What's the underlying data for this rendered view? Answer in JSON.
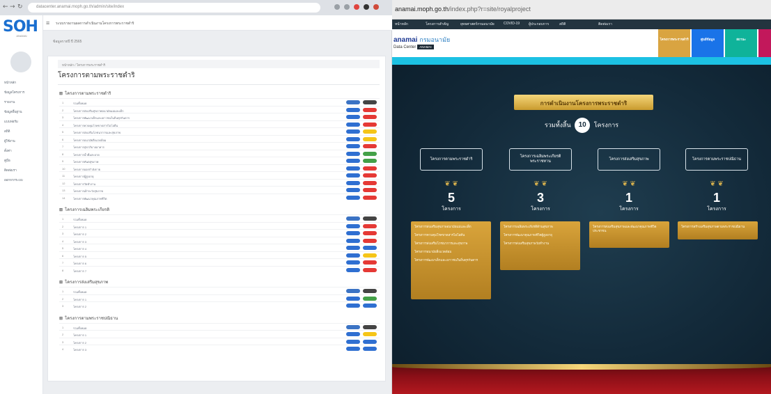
{
  "left": {
    "url": "datacenter.anamai.moph.go.th/admin/site/index",
    "topbar_text": "ระบบรายงานผลการดำเนินงานโครงการพระราชดำริ",
    "subtitle": "ข้อมูลรายปี   ปี 2565",
    "breadcrumb": "หน้าหลัก / โครงการพระราชดำริ",
    "page_title": "โครงการตามพระราชดำริ",
    "logo_big": "SOH",
    "logo_sub": "ANAMAI",
    "sidebar": [
      "หน้าหลัก",
      "ข้อมูลโครงการ",
      "รายงาน",
      "ข้อมูลพื้นฐาน",
      "แบบฟอร์ม",
      "สถิติ",
      "ผู้ใช้งาน",
      "ตั้งค่า",
      "คู่มือ",
      "ติดต่อเรา",
      "ออกจากระบบ"
    ],
    "groups": [
      {
        "title": "โครงการตามพระราชดำริ",
        "rows": [
          {
            "text": "รวมทั้งหมด",
            "c1": "#3b73c4",
            "c2": "#444444"
          },
          {
            "text": "โครงการส่งเสริมสุขภาพอนามัยแม่และเด็ก",
            "c1": "#2f6fd1",
            "c2": "#e53935"
          },
          {
            "text": "โครงการพัฒนาเด็กและเยาวชนในถิ่นทุรกันดาร",
            "c1": "#2f6fd1",
            "c2": "#e53935"
          },
          {
            "text": "โครงการควบคุมโรคขาดสารไอโอดีน",
            "c1": "#2f6fd1",
            "c2": "#e53935"
          },
          {
            "text": "โครงการส่งเสริมโภชนาการและสุขภาพ",
            "c1": "#2f6fd1",
            "c2": "#f5c518"
          },
          {
            "text": "โครงการอนามัยสิ่งแวดล้อม",
            "c1": "#2f6fd1",
            "c2": "#f5c518"
          },
          {
            "text": "โครงการสุขาภิบาลอาหาร",
            "c1": "#2f6fd1",
            "c2": "#e53935"
          },
          {
            "text": "โครงการน้ำดื่มสะอาด",
            "c1": "#2f6fd1",
            "c2": "#43a047"
          },
          {
            "text": "โครงการทันตสุขภาพ",
            "c1": "#2f6fd1",
            "c2": "#43a047"
          },
          {
            "text": "โครงการออกกำลังกาย",
            "c1": "#2f6fd1",
            "c2": "#e53935"
          },
          {
            "text": "โครงการผู้สูงอายุ",
            "c1": "#2f6fd1",
            "c2": "#e53935"
          },
          {
            "text": "โครงการวัยทำงาน",
            "c1": "#2f6fd1",
            "c2": "#e53935"
          },
          {
            "text": "โครงการเฝ้าระวังสุขภาพ",
            "c1": "#2f6fd1",
            "c2": "#e53935"
          },
          {
            "text": "โครงการพัฒนาคุณภาพชีวิต",
            "c1": "#2f6fd1",
            "c2": "#e53935"
          }
        ]
      },
      {
        "title": "โครงการเฉลิมพระเกียรติ",
        "rows": [
          {
            "text": "รวมทั้งหมด",
            "c1": "#3b73c4",
            "c2": "#444444"
          },
          {
            "text": "โครงการ 1",
            "c1": "#2f6fd1",
            "c2": "#e53935"
          },
          {
            "text": "โครงการ 2",
            "c1": "#2f6fd1",
            "c2": "#e53935"
          },
          {
            "text": "โครงการ 3",
            "c1": "#2f6fd1",
            "c2": "#e53935"
          },
          {
            "text": "โครงการ 4",
            "c1": "#2f6fd1",
            "c2": "#2f6fd1"
          },
          {
            "text": "โครงการ 5",
            "c1": "#2f6fd1",
            "c2": "#f5c518"
          },
          {
            "text": "โครงการ 6",
            "c1": "#2f6fd1",
            "c2": "#e53935"
          },
          {
            "text": "โครงการ 7",
            "c1": "#2f6fd1",
            "c2": "#e53935"
          }
        ]
      },
      {
        "title": "โครงการส่งเสริมสุขภาพ",
        "rows": [
          {
            "text": "รวมทั้งหมด",
            "c1": "#3b73c4",
            "c2": "#444444"
          },
          {
            "text": "โครงการ 1",
            "c1": "#2f6fd1",
            "c2": "#43a047"
          },
          {
            "text": "โครงการ 2",
            "c1": "#2f6fd1",
            "c2": "#2f6fd1"
          }
        ]
      },
      {
        "title": "โครงการตามพระราชปณิธาน",
        "rows": [
          {
            "text": "รวมทั้งหมด",
            "c1": "#3b73c4",
            "c2": "#444444"
          },
          {
            "text": "โครงการ 1",
            "c1": "#2f6fd1",
            "c2": "#f5c518"
          },
          {
            "text": "โครงการ 2",
            "c1": "#2f6fd1",
            "c2": "#2f6fd1"
          },
          {
            "text": "โครงการ 3",
            "c1": "#2f6fd1",
            "c2": "#2f6fd1"
          }
        ]
      }
    ]
  },
  "right": {
    "url_domain": "anamai.moph.go.th",
    "url_path": "/index.php?r=site/royalproject",
    "nav": [
      "หน้าหลัก",
      "โครงการสำคัญ",
      "ยุทธศาสตร์กรมอนามัย",
      "COVID-19",
      "ผู้ประกอบการ",
      "สถิติ",
      "ติดต่อเรา"
    ],
    "brand_main": "anamai",
    "brand_th": "กรมอนามัย",
    "brand_sub": "Data Center",
    "brand_tag": "ANAMAI",
    "tiles": [
      {
        "label": "โครงการพระราชดำริ",
        "color": "#d9a441"
      },
      {
        "label": "ศูนย์ข้อมูล",
        "color": "#1a73e8"
      },
      {
        "label": "สถานะ",
        "color": "#0fb39a"
      }
    ],
    "banner": "การดำเนินงานโครงการพระราชดำริ",
    "total_prefix": "รวมทั้งสิ้น",
    "total_value": "10",
    "total_suffix": "โครงการ",
    "categories": [
      {
        "label": "โครงการตามพระราชดำริ",
        "count": "5",
        "unit": "โครงการ"
      },
      {
        "label": "โครงการเฉลิมพระเกียรติพระราชทาน",
        "count": "3",
        "unit": "โครงการ"
      },
      {
        "label": "โครงการส่งเสริมสุขภาพ",
        "count": "1",
        "unit": "โครงการ"
      },
      {
        "label": "โครงการตามพระราชปณิธาน",
        "count": "1",
        "unit": "โครงการ"
      }
    ],
    "cards": [
      [
        "โครงการส่งเสริมสุขภาพอนามัยแม่และเด็ก",
        "โครงการควบคุมโรคขาดสารไอโอดีน",
        "โครงการส่งเสริมโภชนาการและสุขภาพ",
        "โครงการอนามัยสิ่งแวดล้อม",
        "โครงการพัฒนาเด็กและเยาวชนในถิ่นทุรกันดาร"
      ],
      [
        "โครงการเฉลิมพระเกียรติด้านสุขภาพ",
        "โครงการพัฒนาคุณภาพชีวิตผู้สูงอายุ",
        "โครงการส่งเสริมสุขภาพวัยทำงาน"
      ],
      [
        "โครงการส่งเสริมสุขภาพและพัฒนาคุณภาพชีวิตประชาชน"
      ],
      [
        "โครงการสร้างเสริมสุขภาพตามพระราชปณิธาน"
      ]
    ]
  }
}
